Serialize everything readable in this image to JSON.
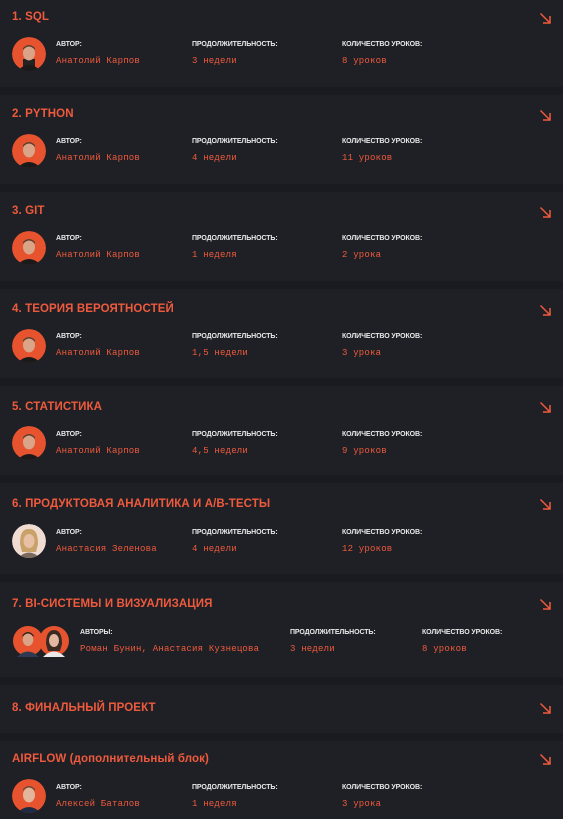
{
  "colors": {
    "background": "#191b20",
    "card": "#1e2026",
    "accent": "#f05a3c",
    "label": "#e9e9ea"
  },
  "labels": {
    "author": "АВТОР:",
    "authors": "АВТОРЫ:",
    "duration": "ПРОДОЛЖИТЕЛЬНОСТЬ:",
    "lessons": "КОЛИЧЕСТВО УРОКОВ:"
  },
  "modules": [
    {
      "title": "1. SQL",
      "author": "Анатолий Карпов",
      "duration": "3 недели",
      "lessons": "8 уроков",
      "avatar": "avatar-karpov",
      "arrow": "arrow-down-right-icon"
    },
    {
      "title": "2. PYTHON",
      "author": "Анатолий Карпов",
      "duration": "4 недели",
      "lessons": "11 уроков",
      "avatar": "avatar-karpov",
      "arrow": "arrow-down-right-icon"
    },
    {
      "title": "3. GIT",
      "author": "Анатолий Карпов",
      "duration": "1 неделя",
      "lessons": "2 урока",
      "avatar": "avatar-karpov",
      "arrow": "arrow-down-right-icon"
    },
    {
      "title": "4. ТЕОРИЯ ВЕРОЯТНОСТЕЙ",
      "author": "Анатолий Карпов",
      "duration": "1,5 недели",
      "lessons": "3 урока",
      "avatar": "avatar-karpov",
      "arrow": "arrow-down-right-icon"
    },
    {
      "title": "5. СТАТИСТИКА",
      "author": "Анатолий Карпов",
      "duration": "4,5 недели",
      "lessons": "9 уроков",
      "avatar": "avatar-karpov",
      "arrow": "arrow-down-right-icon"
    },
    {
      "title": "6. ПРОДУКТОВАЯ АНАЛИТИКА И А/В-ТЕСТЫ",
      "author": "Анастасия Зеленова",
      "duration": "4 недели",
      "lessons": "12 уроков",
      "avatar": "avatar-zelenova",
      "arrow": "arrow-down-right-icon"
    },
    {
      "title": "7. BI-СИСТЕМЫ И ВИЗУАЛИЗАЦИЯ",
      "author": "Роман Бунин, Анастасия Кузнецова",
      "duration": "3 недели",
      "lessons": "8 уроков",
      "avatar": "avatar-bunin-kuznetsova",
      "arrow": "arrow-down-right-icon"
    },
    {
      "title": "8. ФИНАЛЬНЫЙ ПРОЕКТ",
      "arrow": "arrow-down-right-icon"
    },
    {
      "title": "AIRFLOW (дополнительный блок)",
      "author": "Алексей Баталов",
      "duration": "1 неделя",
      "lessons": "3 урока",
      "avatar": "avatar-batalov",
      "arrow": "arrow-down-right-icon"
    }
  ]
}
